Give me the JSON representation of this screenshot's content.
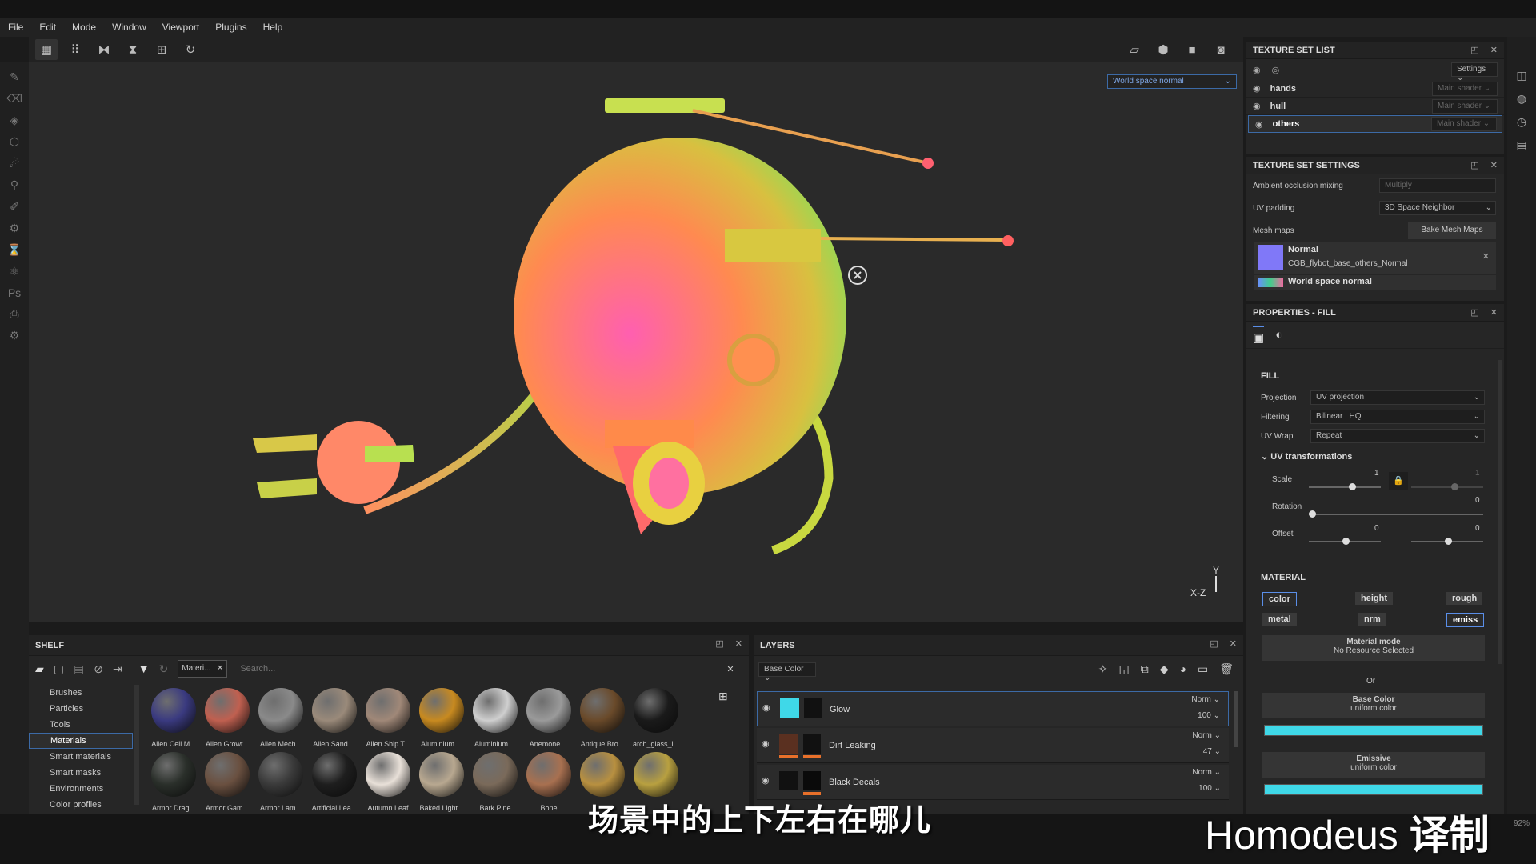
{
  "menu": [
    "File",
    "Edit",
    "Mode",
    "Window",
    "Viewport",
    "Plugins",
    "Help"
  ],
  "viewport": {
    "mode_dropdown": "World space normal",
    "axis_y": "Y",
    "axis_xz": "X-Z"
  },
  "texture_set_list": {
    "title": "TEXTURE SET LIST",
    "settings_label": "Settings",
    "items": [
      {
        "name": "hands",
        "shader": "Main shader"
      },
      {
        "name": "hull",
        "shader": "Main shader"
      },
      {
        "name": "others",
        "shader": "Main shader"
      }
    ]
  },
  "texture_set_settings": {
    "title": "TEXTURE SET SETTINGS",
    "ao_label": "Ambient occlusion mixing",
    "ao_value": "Multiply",
    "uv_padding_label": "UV padding",
    "uv_padding_value": "3D Space Neighbor",
    "mesh_maps_label": "Mesh maps",
    "bake_button": "Bake Mesh Maps",
    "map1_name": "Normal",
    "map1_file": "CGB_flybot_base_others_Normal",
    "map2_name": "World space normal"
  },
  "properties": {
    "title": "PROPERTIES - FILL",
    "fill_header": "FILL",
    "projection_label": "Projection",
    "projection_value": "UV projection",
    "filtering_label": "Filtering",
    "filtering_value": "Bilinear | HQ",
    "uvwrap_label": "UV Wrap",
    "uvwrap_value": "Repeat",
    "uvt_label": "UV transformations",
    "scale_label": "Scale",
    "scale_value": "1",
    "scale_value2": "1",
    "rotation_label": "Rotation",
    "rotation_value": "0",
    "offset_label": "Offset",
    "offset_value1": "0",
    "offset_value2": "0",
    "material_header": "MATERIAL",
    "chips": [
      "color",
      "height",
      "rough",
      "metal",
      "nrm",
      "emiss"
    ],
    "material_mode": "Material mode",
    "no_resource": "No Resource Selected",
    "or": "Or",
    "base_color": "Base Color",
    "uniform1": "uniform color",
    "emissive": "Emissive",
    "uniform2": "uniform color",
    "accent_color": "#3fd8e8"
  },
  "shelf": {
    "title": "SHELF",
    "filter_tag": "Materi...",
    "search_placeholder": "Search...",
    "categories": [
      "Brushes",
      "Particles",
      "Tools",
      "Materials",
      "Smart materials",
      "Smart masks",
      "Environments",
      "Color profiles"
    ],
    "materials_row1": [
      "Alien Cell M...",
      "Alien Growt...",
      "Alien Mech...",
      "Alien Sand ...",
      "Alien Ship T...",
      "Aluminium ...",
      "Aluminium ...",
      "Anemone ...",
      "Antique Bro...",
      "arch_glass_l..."
    ],
    "materials_row2": [
      "Armor Drag...",
      "Armor Gam...",
      "Armor Lam...",
      "Artificial Lea...",
      "Autumn Leaf",
      "Baked Light...",
      "Bark Pine",
      "Bone",
      "",
      ""
    ]
  },
  "layers": {
    "title": "LAYERS",
    "channel": "Base Color",
    "items": [
      {
        "name": "Glow",
        "blend": "Norm",
        "opacity": "100"
      },
      {
        "name": "Dirt Leaking",
        "blend": "Norm",
        "opacity": "47"
      },
      {
        "name": "Black Decals",
        "blend": "Norm",
        "opacity": "100"
      }
    ]
  },
  "subtitle": "场景中的上下左右在哪儿",
  "watermark_text": "Homodeus",
  "watermark_bold": "译制",
  "zoom": "92%"
}
